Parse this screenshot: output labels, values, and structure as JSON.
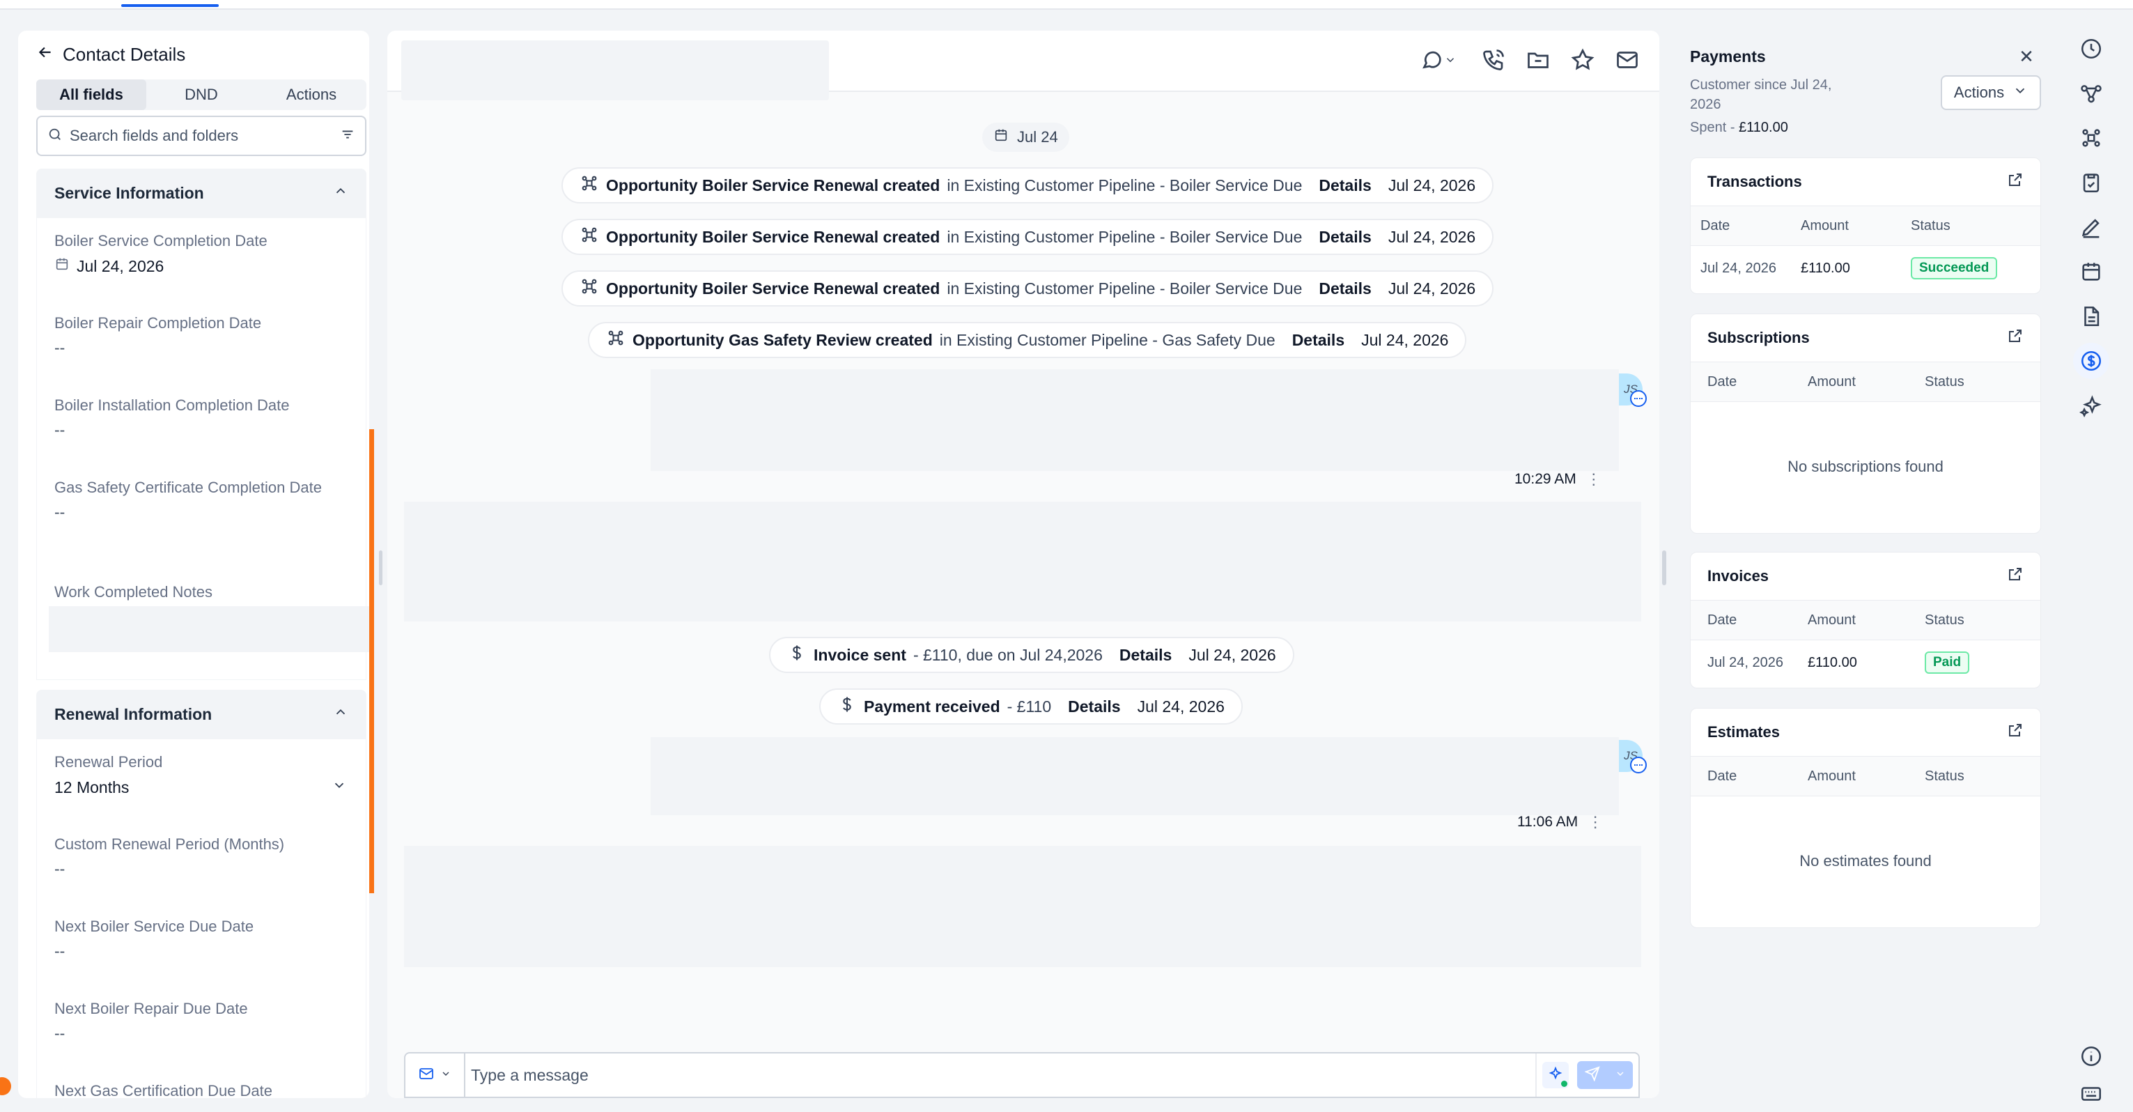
{
  "contact_panel": {
    "title": "Contact Details",
    "tabs": [
      "All fields",
      "DND",
      "Actions"
    ],
    "active_tab": "All fields",
    "search_placeholder": "Search fields and folders",
    "sections": [
      {
        "title": "Service Information",
        "fields": [
          {
            "label": "Boiler Service Completion Date",
            "value": "Jul 24, 2026"
          },
          {
            "label": "Boiler Repair Completion Date",
            "value": "--"
          },
          {
            "label": "Boiler Installation Completion Date",
            "value": "--"
          },
          {
            "label": "Gas Safety Certificate Completion Date",
            "value": "--"
          },
          {
            "label": "Work Completed Notes",
            "value": ""
          }
        ]
      },
      {
        "title": "Renewal Information",
        "fields": [
          {
            "label": "Renewal Period",
            "value": "12 Months"
          },
          {
            "label": "Custom Renewal Period (Months)",
            "value": "--"
          },
          {
            "label": "Next Boiler Service Due Date",
            "value": "--"
          },
          {
            "label": "Next Boiler Repair Due Date",
            "value": "--"
          },
          {
            "label": "Next Gas Certification Due Date",
            "value": ""
          }
        ]
      }
    ]
  },
  "conversation": {
    "date_chip": "Jul 24",
    "activities": [
      {
        "title": "Opportunity Boiler Service Renewal created",
        "rest": "in Existing Customer Pipeline - Boiler Service Due",
        "details": "Details",
        "date": "Jul 24, 2026",
        "icon": "pipeline-icon"
      },
      {
        "title": "Opportunity Boiler Service Renewal created",
        "rest": "in Existing Customer Pipeline - Boiler Service Due",
        "details": "Details",
        "date": "Jul 24, 2026",
        "icon": "pipeline-icon"
      },
      {
        "title": "Opportunity Boiler Service Renewal created",
        "rest": "in Existing Customer Pipeline - Boiler Service Due",
        "details": "Details",
        "date": "Jul 24, 2026",
        "icon": "pipeline-icon"
      },
      {
        "title": "Opportunity Gas Safety Review created",
        "rest": "in Existing Customer Pipeline - Gas Safety Due",
        "details": "Details",
        "date": "Jul 24, 2026",
        "icon": "pipeline-icon"
      },
      {
        "title": "Invoice sent",
        "rest": "- £110, due on Jul 24,2026",
        "details": "Details",
        "date": "Jul 24, 2026",
        "icon": "dollar-icon"
      },
      {
        "title": "Payment received",
        "rest": "- £110",
        "details": "Details",
        "date": "Jul 24, 2026",
        "icon": "dollar-icon"
      }
    ],
    "avatar_initials": "JS",
    "message_times": [
      "10:29 AM",
      "11:06 AM"
    ],
    "composer_placeholder": "Type a message"
  },
  "payments": {
    "title": "Payments",
    "customer_since": "Customer since Jul 24, 2026",
    "spent_label": "Spent -",
    "spent_value": "£110.00",
    "actions_label": "Actions",
    "columns": [
      "Date",
      "Amount",
      "Status"
    ],
    "transactions": {
      "title": "Transactions",
      "rows": [
        {
          "date": "Jul 24, 2026",
          "amount": "£110.00",
          "status": "Succeeded"
        }
      ]
    },
    "subscriptions": {
      "title": "Subscriptions",
      "empty": "No subscriptions found"
    },
    "invoices": {
      "title": "Invoices",
      "rows": [
        {
          "date": "Jul 24, 2026",
          "amount": "£110.00",
          "status": "Paid"
        }
      ]
    },
    "estimates": {
      "title": "Estimates",
      "empty": "No estimates found"
    }
  },
  "colors": {
    "accent": "#155eef",
    "highlight": "#f97316",
    "success": "#039855"
  },
  "rail_icons": [
    "clock-icon",
    "workflow-icon",
    "pipeline-icon",
    "clipboard-check-icon",
    "pen-icon",
    "calendar-icon",
    "document-icon",
    "dollar-circle-icon",
    "sparkles-icon",
    "info-icon",
    "keyboard-icon"
  ]
}
